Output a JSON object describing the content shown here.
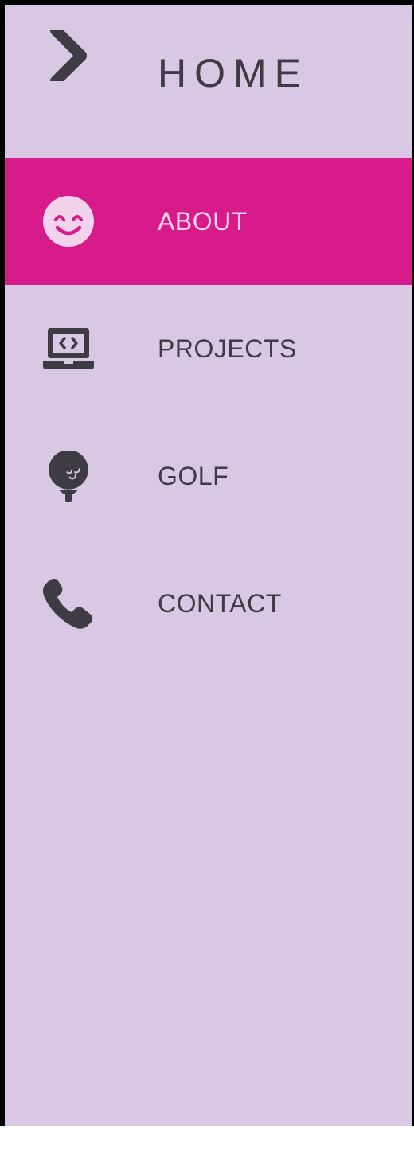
{
  "colors": {
    "sidebar_background": "#d8c8e3",
    "active_background": "#d71b8a",
    "text": "#3f3b45",
    "active_text": "#f3d3ec",
    "frame": "#000000"
  },
  "nav": {
    "home": {
      "label": "HOME",
      "icon": "chevron-right-icon"
    },
    "items": [
      {
        "label": "ABOUT",
        "icon": "smiley-icon",
        "active": true
      },
      {
        "label": "PROJECTS",
        "icon": "laptop-code-icon",
        "active": false
      },
      {
        "label": "GOLF",
        "icon": "golf-ball-icon",
        "active": false
      },
      {
        "label": "CONTACT",
        "icon": "phone-icon",
        "active": false
      }
    ]
  }
}
